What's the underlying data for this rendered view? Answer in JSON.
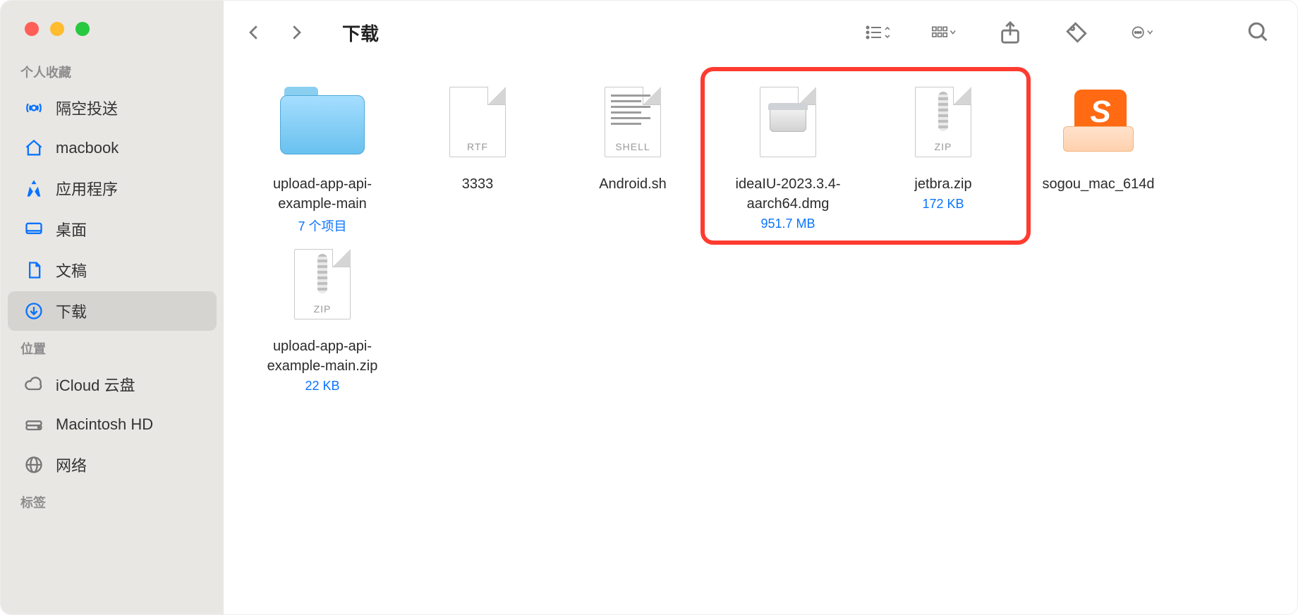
{
  "window_title": "下载",
  "sidebar": {
    "sections": [
      {
        "label": "个人收藏",
        "items": [
          {
            "icon": "airdrop",
            "label": "隔空投送"
          },
          {
            "icon": "home",
            "label": "macbook"
          },
          {
            "icon": "apps",
            "label": "应用程序"
          },
          {
            "icon": "desktop",
            "label": "桌面"
          },
          {
            "icon": "document",
            "label": "文稿"
          },
          {
            "icon": "download",
            "label": "下载",
            "active": true
          }
        ]
      },
      {
        "label": "位置",
        "items": [
          {
            "icon": "cloud",
            "label": "iCloud 云盘"
          },
          {
            "icon": "drive",
            "label": "Macintosh HD"
          },
          {
            "icon": "globe",
            "label": "网络"
          }
        ]
      },
      {
        "label": "标签",
        "items": []
      }
    ]
  },
  "files": [
    {
      "name": "upload-app-api-example-main",
      "sub": "7 个项目",
      "kind": "folder"
    },
    {
      "name": "3333",
      "sub": "",
      "kind": "rtf",
      "badge": "RTF"
    },
    {
      "name": "Android.sh",
      "sub": "",
      "kind": "shell",
      "badge": "SHELL"
    },
    {
      "name": "ideaIU-2023.3.4-aarch64.dmg",
      "sub": "951.7 MB",
      "kind": "dmg"
    },
    {
      "name": "jetbra.zip",
      "sub": "172 KB",
      "kind": "zip",
      "badge": "ZIP"
    },
    {
      "name": "sogou_mac_614d",
      "sub": "",
      "kind": "app"
    },
    {
      "name": "upload-app-api-example-main.zip",
      "sub": "22 KB",
      "kind": "zip",
      "badge": "ZIP"
    }
  ],
  "highlight": {
    "start": 3,
    "end": 4
  }
}
